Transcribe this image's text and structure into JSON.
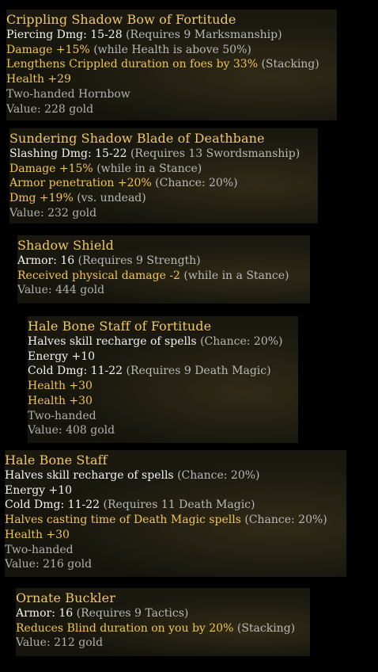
{
  "tooltips": [
    {
      "title": "Crippling Shadow Bow of Fortitude",
      "lines": [
        {
          "text": "Piercing Dmg: 15-28",
          "style": "white",
          "note": " (Requires 9 Marksmanship)"
        },
        {
          "text": "Damage +15%",
          "style": "gold",
          "note": " (while Health is above 50%)"
        },
        {
          "text": "Lengthens Crippled duration on foes by 33%",
          "style": "gold",
          "note": " (Stacking)"
        },
        {
          "text": "Health +29",
          "style": "gold",
          "note": ""
        },
        {
          "text": "Two-handed Hornbow",
          "style": "grey",
          "note": ""
        },
        {
          "text": "Value: 228 gold",
          "style": "grey",
          "note": ""
        }
      ]
    },
    {
      "title": "Sundering Shadow Blade of Deathbane",
      "lines": [
        {
          "text": "Slashing Dmg: 15-22",
          "style": "white",
          "note": " (Requires 13 Swordsmanship)"
        },
        {
          "text": "Damage +15%",
          "style": "gold",
          "note": " (while in a Stance)"
        },
        {
          "text": "Armor penetration +20%",
          "style": "gold",
          "note": " (Chance: 20%)"
        },
        {
          "text": "Dmg +19%",
          "style": "gold",
          "note": " (vs. undead)"
        },
        {
          "text": "Value: 232 gold",
          "style": "grey",
          "note": ""
        }
      ]
    },
    {
      "title": "Shadow Shield",
      "lines": [
        {
          "text": "Armor: 16",
          "style": "white",
          "note": " (Requires 9 Strength)"
        },
        {
          "text": "Received physical damage -2",
          "style": "gold",
          "note": " (while in a Stance)"
        },
        {
          "text": "Value: 444 gold",
          "style": "grey",
          "note": ""
        }
      ]
    },
    {
      "title": "Hale Bone Staff of Fortitude",
      "lines": [
        {
          "text": "Halves skill recharge of spells",
          "style": "white",
          "note": " (Chance: 20%)"
        },
        {
          "text": "Energy +10",
          "style": "white",
          "note": ""
        },
        {
          "text": "Cold Dmg: 11-22",
          "style": "white",
          "note": " (Requires 9 Death Magic)"
        },
        {
          "text": "Health +30",
          "style": "gold",
          "note": ""
        },
        {
          "text": "Health +30",
          "style": "gold",
          "note": ""
        },
        {
          "text": "Two-handed",
          "style": "grey",
          "note": ""
        },
        {
          "text": "Value: 408 gold",
          "style": "grey",
          "note": ""
        }
      ]
    },
    {
      "title": "Hale Bone Staff",
      "lines": [
        {
          "text": "Halves skill recharge of spells",
          "style": "white",
          "note": " (Chance: 20%)"
        },
        {
          "text": "Energy +10",
          "style": "white",
          "note": ""
        },
        {
          "text": "Cold Dmg: 11-22",
          "style": "white",
          "note": " (Requires 11 Death Magic)"
        },
        {
          "text": "Halves casting time of Death Magic spells",
          "style": "gold",
          "note": " (Chance: 20%)"
        },
        {
          "text": "Health +30",
          "style": "gold",
          "note": ""
        },
        {
          "text": "Two-handed",
          "style": "grey",
          "note": ""
        },
        {
          "text": "Value: 216 gold",
          "style": "grey",
          "note": ""
        }
      ]
    },
    {
      "title": "Ornate Buckler",
      "lines": [
        {
          "text": "Armor: 16",
          "style": "white",
          "note": " (Requires 9 Tactics)"
        },
        {
          "text": "Reduces Blind duration on you by 20%",
          "style": "gold",
          "note": " (Stacking)"
        },
        {
          "text": "Value: 212 gold",
          "style": "grey",
          "note": ""
        }
      ]
    }
  ],
  "colors": {
    "title": "#f0c860",
    "stat_white": "#f2f2f2",
    "stat_gold": "#f2c452",
    "note_grey": "#b0b0b0",
    "background": "#000000"
  }
}
